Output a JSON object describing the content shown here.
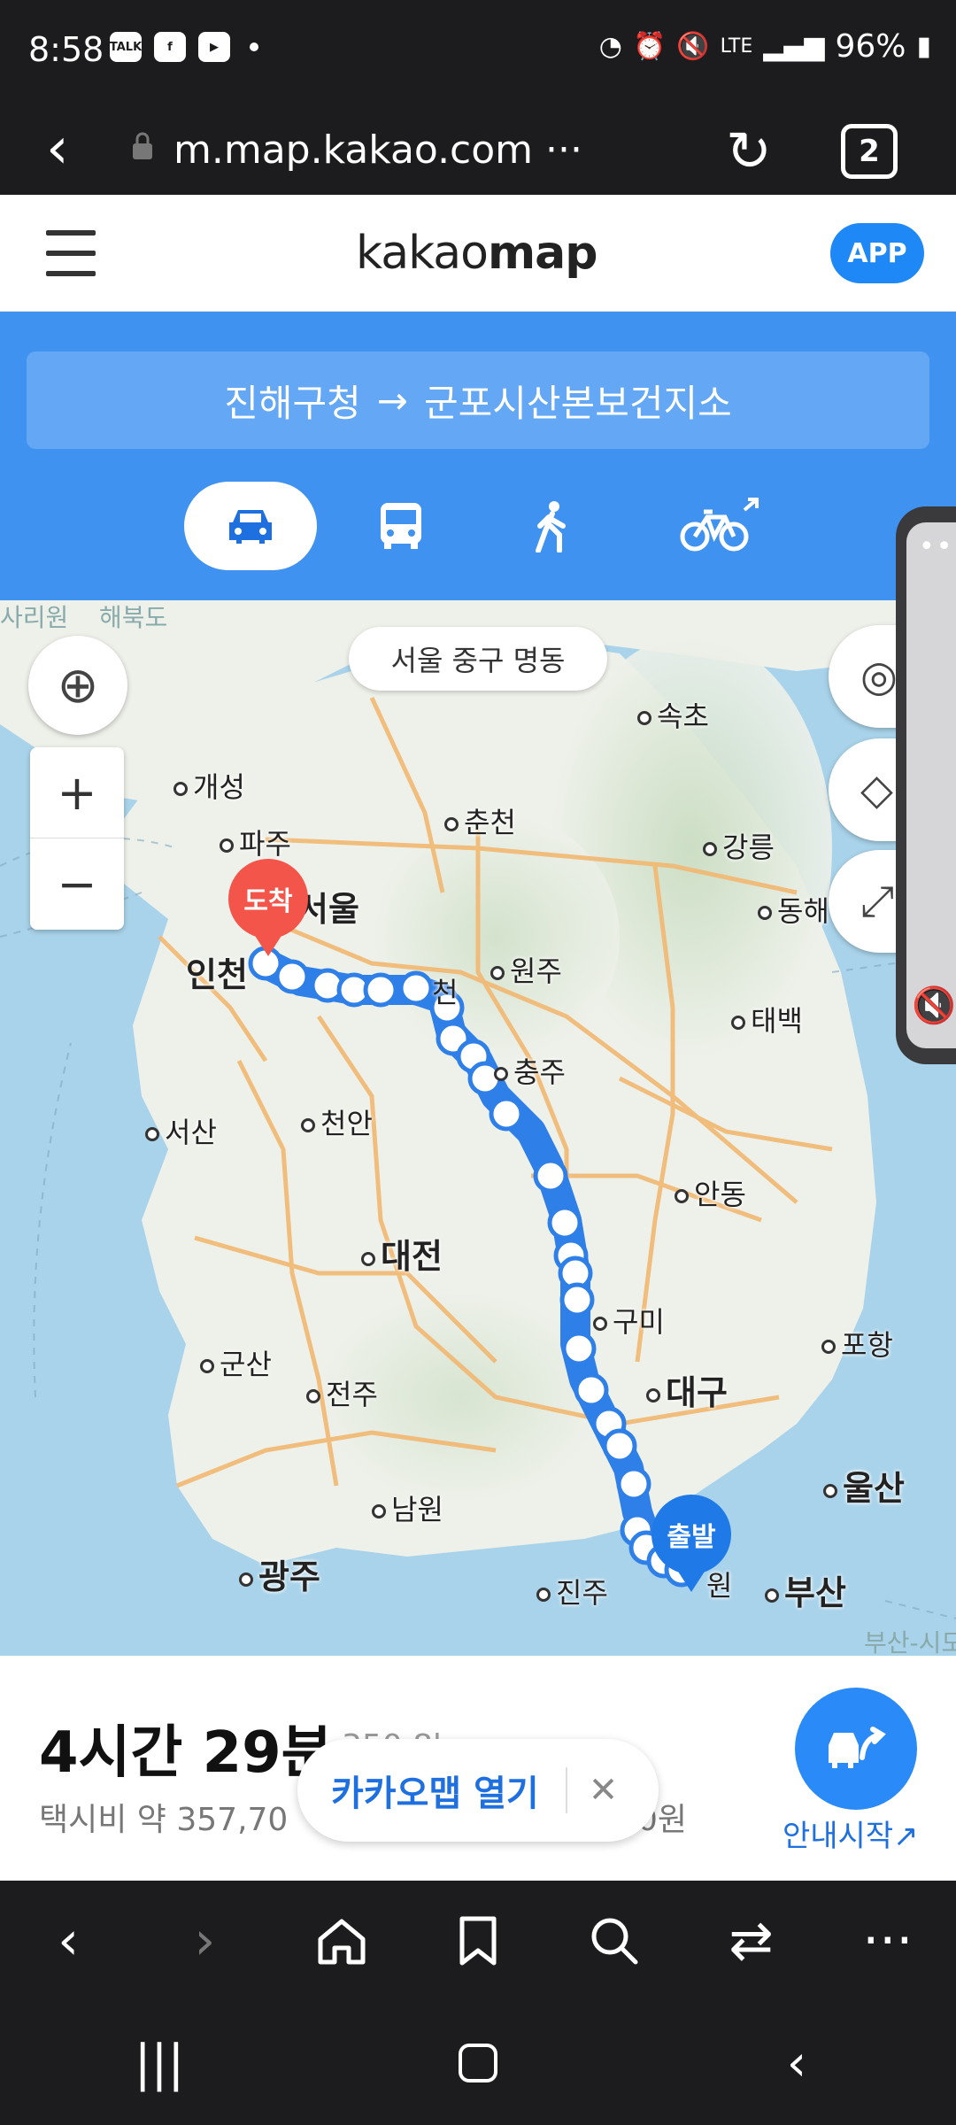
{
  "status": {
    "time": "8:58",
    "notif_icons": [
      "TALK",
      "f",
      "▶"
    ],
    "network": "LTE",
    "battery": "96%"
  },
  "browser": {
    "url": "m.map.kakao.com ···",
    "tab_count": "2"
  },
  "header": {
    "logo_light": "kakao",
    "logo_bold": "map",
    "app_button": "APP"
  },
  "route": {
    "origin": "진해구청",
    "arrow": "→",
    "destination": "군포시산본보건지소",
    "modes": [
      "car",
      "bus",
      "walk",
      "bike"
    ],
    "active_mode": "car"
  },
  "map": {
    "address_chip": "서울 중구 명동",
    "zoom_in": "+",
    "zoom_out": "−",
    "pins": {
      "destination": "도착",
      "origin": "출발"
    },
    "cities": [
      {
        "name": "개성"
      },
      {
        "name": "파주"
      },
      {
        "name": "서울",
        "big": true
      },
      {
        "name": "인천",
        "big": true
      },
      {
        "name": "춘천"
      },
      {
        "name": "속초"
      },
      {
        "name": "강릉"
      },
      {
        "name": "동해"
      },
      {
        "name": "원주"
      },
      {
        "name": "천"
      },
      {
        "name": "충주"
      },
      {
        "name": "태백"
      },
      {
        "name": "서산"
      },
      {
        "name": "천안"
      },
      {
        "name": "대전",
        "big": true
      },
      {
        "name": "안동"
      },
      {
        "name": "구미"
      },
      {
        "name": "포항"
      },
      {
        "name": "대구",
        "big": true
      },
      {
        "name": "군산"
      },
      {
        "name": "전주"
      },
      {
        "name": "울산",
        "big": true
      },
      {
        "name": "남원"
      },
      {
        "name": "광주",
        "big": true
      },
      {
        "name": "진주"
      },
      {
        "name": "부산",
        "big": true
      },
      {
        "name": "원"
      }
    ],
    "faint_labels": [
      "사리원",
      "해북도",
      "부산-시모"
    ]
  },
  "summary": {
    "duration": "4시간 29분",
    "distance": "350.8km",
    "fare_prefix": "택시비 약 357,70",
    "fare_suffix": "0원",
    "open_app_label": "카카오맵 열기",
    "close": "✕",
    "guide_label": "안내시작↗"
  },
  "colors": {
    "brand_blue": "#3f92f0",
    "route_line": "#2f7fe8",
    "pin_destination": "#f4554a",
    "pin_origin": "#1f7ae8"
  }
}
